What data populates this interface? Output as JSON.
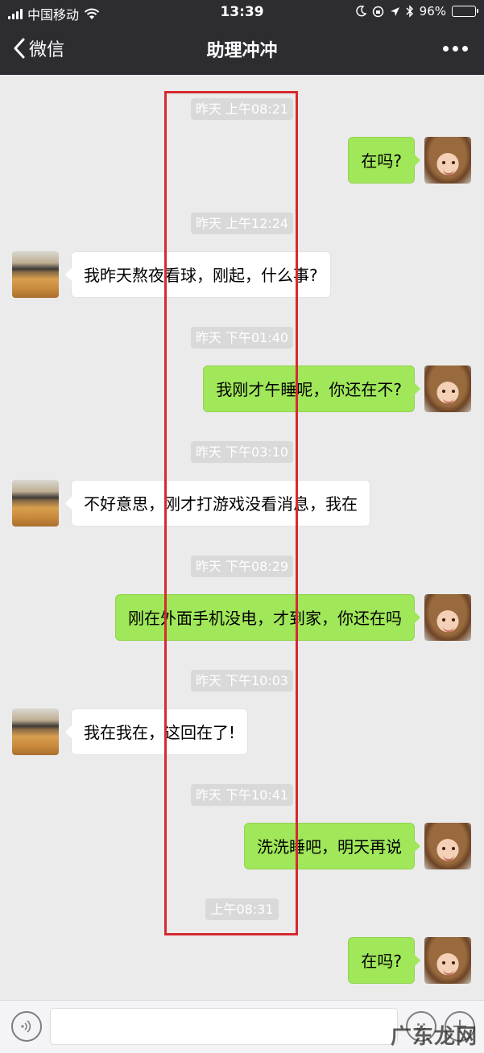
{
  "status_bar": {
    "carrier": "中国移动",
    "time": "13:39",
    "battery": "96%",
    "battery_level": 0.96
  },
  "nav": {
    "back_label": "微信",
    "title": "助理冲冲",
    "more_icon": "ellipsis-icon"
  },
  "messages": [
    {
      "timestamp": "昨天 上午08:21",
      "side": "me",
      "text": "在吗?"
    },
    {
      "timestamp": "昨天 上午12:24",
      "side": "them",
      "text": "我昨天熬夜看球，刚起，什么事?"
    },
    {
      "timestamp": "昨天 下午01:40",
      "side": "me",
      "text": "我刚才午睡呢，你还在不?"
    },
    {
      "timestamp": "昨天 下午03:10",
      "side": "them",
      "text": "不好意思，刚才打游戏没看消息，我在"
    },
    {
      "timestamp": "昨天 下午08:29",
      "side": "me",
      "text": "刚在外面手机没电，才到家，你还在吗"
    },
    {
      "timestamp": "昨天 下午10:03",
      "side": "them",
      "text": "我在我在，这回在了!"
    },
    {
      "timestamp": "昨天 下午10:41",
      "side": "me",
      "text": "洗洗睡吧，明天再说"
    },
    {
      "timestamp": "上午08:31",
      "side": "me",
      "text": "在吗?"
    }
  ],
  "input_bar": {
    "placeholder": "",
    "voice_icon": "voice-icon",
    "emoji_icon": "emoji-icon",
    "plus_icon": "plus-icon"
  },
  "watermark": "广东龙网",
  "colors": {
    "nav_bg": "#2d2d31",
    "chat_bg": "#ebebeb",
    "my_bubble": "#a0e75a",
    "their_bubble": "#ffffff",
    "highlight_frame": "#d52a2f"
  }
}
